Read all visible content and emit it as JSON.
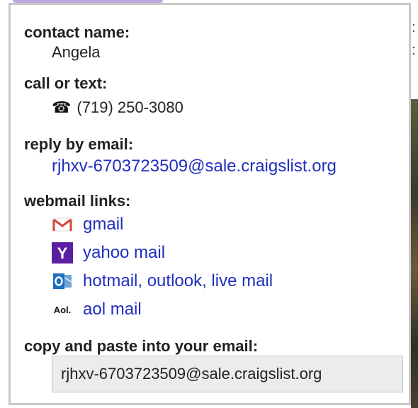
{
  "contact": {
    "name_label": "contact name:",
    "name": "Angela"
  },
  "call": {
    "label": "call or text:",
    "phone_icon": "telephone-icon",
    "phone": "(719) 250-3080"
  },
  "reply": {
    "label": "reply by email:",
    "email": "rjhxv-6703723509@sale.craigslist.org"
  },
  "webmail": {
    "label": "webmail links:",
    "links": [
      {
        "icon": "gmail-icon",
        "label": "gmail"
      },
      {
        "icon": "yahoo-icon",
        "label": "yahoo mail"
      },
      {
        "icon": "outlook-icon",
        "label": "hotmail, outlook, live mail"
      },
      {
        "icon": "aol-icon",
        "label": "aol mail",
        "icon_text": "Aol."
      }
    ]
  },
  "copy": {
    "label": "copy and paste into your email:",
    "email": "rjhxv-6703723509@sale.craigslist.org"
  },
  "colors": {
    "link": "#1f2fbf",
    "border": "#c8c8c8",
    "copybox_bg": "#ececec"
  }
}
